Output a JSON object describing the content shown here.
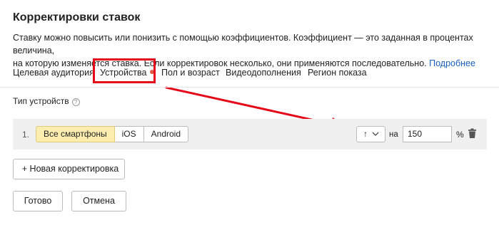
{
  "header": {
    "title": "Корректировки ставок",
    "description_line1": "Ставку можно повысить или понизить с помощью коэффициентов. Коэффициент — это заданная в процентах величина,",
    "description_line2": "на которую изменяется ставка. Если корректировок несколько, они применяются последовательно.",
    "more_link": "Подробнее"
  },
  "tabs": [
    {
      "label": "Целевая аудитория",
      "active": false
    },
    {
      "label": "Устройства",
      "active": true,
      "has_indicator": true
    },
    {
      "label": "Пол и возраст",
      "active": false
    },
    {
      "label": "Видеодополнения",
      "active": false
    },
    {
      "label": "Регион показа",
      "active": false
    }
  ],
  "section": {
    "label": "Тип устройств",
    "help_icon": "?"
  },
  "row": {
    "number": "1.",
    "segments": [
      {
        "label": "Все смартфоны",
        "active": true
      },
      {
        "label": "iOS",
        "active": false
      },
      {
        "label": "Android",
        "active": false
      }
    ],
    "direction_symbol": "↑",
    "preposition": "на",
    "value": "150",
    "unit": "%"
  },
  "buttons": {
    "add": "+ Новая корректировка",
    "done": "Готово",
    "cancel": "Отмена"
  },
  "colors": {
    "accent_link": "#1a5fc2",
    "annotation_red": "#e5081a",
    "active_segment": "#fdeeb0",
    "tab_indicator": "#e05a4a"
  }
}
